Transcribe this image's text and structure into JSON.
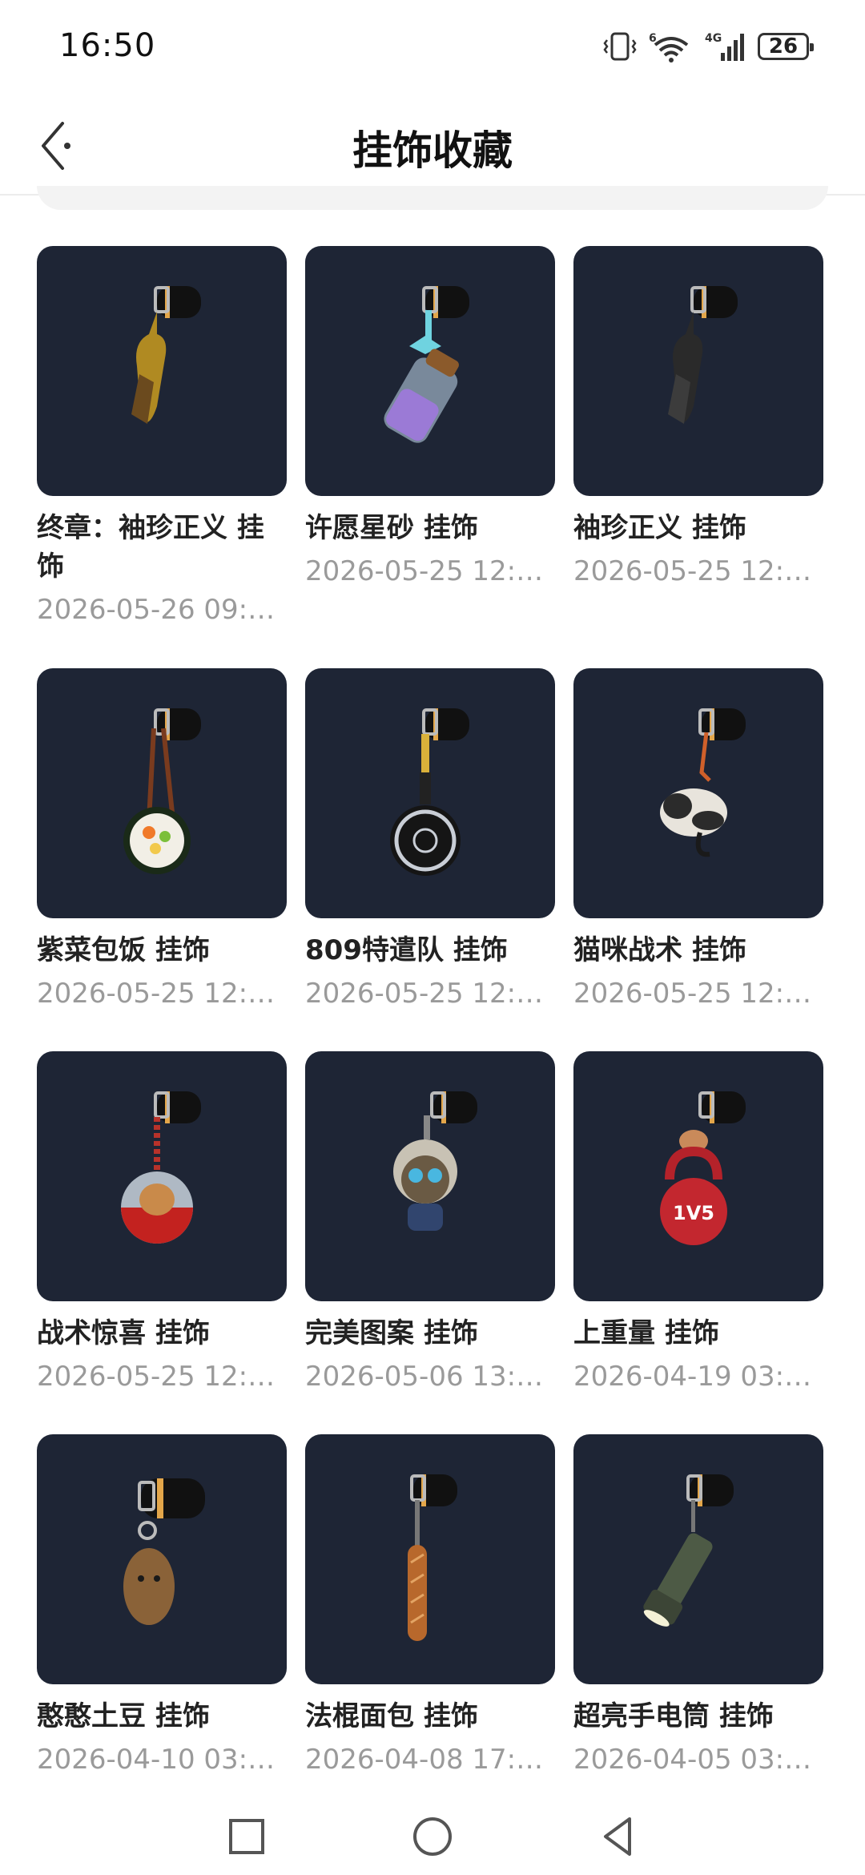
{
  "status": {
    "time": "16:50",
    "network": "4G",
    "network_gen": "6",
    "battery": "26"
  },
  "header": {
    "title": "挂饰收藏"
  },
  "items": [
    {
      "name": "终章：袖珍正义 挂饰",
      "date": "2026-05-26 09:…",
      "icon": "golden-pistol-charm"
    },
    {
      "name": "许愿星砂 挂饰",
      "date": "2026-05-25 12:…",
      "icon": "star-sand-bottle-charm"
    },
    {
      "name": "袖珍正义 挂饰",
      "date": "2026-05-25 12:…",
      "icon": "black-pistol-charm"
    },
    {
      "name": "紫菜包饭 挂饰",
      "date": "2026-05-25 12:…",
      "icon": "kimbap-charm"
    },
    {
      "name": "809特遣队 挂饰",
      "date": "2026-05-25 12:…",
      "icon": "frying-pan-charm"
    },
    {
      "name": "猫咪战术 挂饰",
      "date": "2026-05-25 12:…",
      "icon": "cat-charm"
    },
    {
      "name": "战术惊喜 挂饰",
      "date": "2026-05-25 12:…",
      "icon": "capsule-toy-charm"
    },
    {
      "name": "完美图案 挂饰",
      "date": "2026-05-06 13:…",
      "icon": "doll-charm"
    },
    {
      "name": "上重量 挂饰",
      "date": "2026-04-19 03:…",
      "icon": "kettlebell-charm",
      "label": "1V5"
    },
    {
      "name": "憨憨土豆 挂饰",
      "date": "2026-04-10 03:…",
      "icon": "potato-charm"
    },
    {
      "name": "法棍面包 挂饰",
      "date": "2026-04-08 17:…",
      "icon": "baguette-charm"
    },
    {
      "name": "超亮手电筒 挂饰",
      "date": "2026-04-05 03:…",
      "icon": "flashlight-charm"
    }
  ]
}
